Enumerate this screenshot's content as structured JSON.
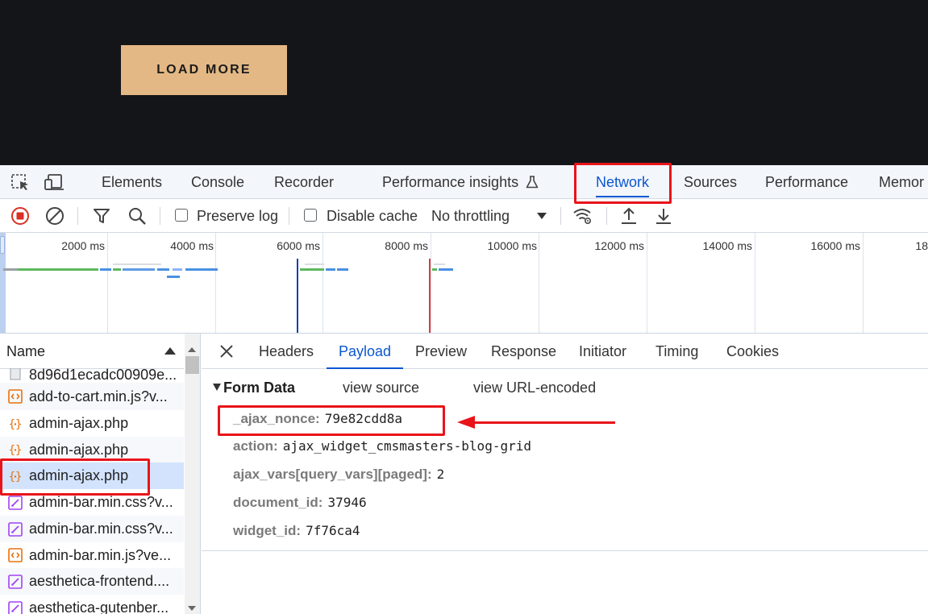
{
  "site": {
    "load_more_label": "LOAD MORE"
  },
  "devtools": {
    "tabs": [
      {
        "label": "Elements"
      },
      {
        "label": "Console"
      },
      {
        "label": "Recorder"
      },
      {
        "label": "Performance insights"
      },
      {
        "label": "Network",
        "active": true
      },
      {
        "label": "Sources"
      },
      {
        "label": "Performance"
      },
      {
        "label": "Memor"
      }
    ],
    "toolbar": {
      "preserve_log_label": "Preserve log",
      "preserve_log_checked": false,
      "disable_cache_label": "Disable cache",
      "disable_cache_checked": false,
      "throttling_value": "No throttling"
    },
    "overview": {
      "ticks": [
        "2000 ms",
        "4000 ms",
        "6000 ms",
        "8000 ms",
        "10000 ms",
        "12000 ms",
        "14000 ms",
        "16000 ms",
        "18"
      ]
    },
    "request_list": {
      "column_header": "Name",
      "rows": [
        {
          "name": "8d96d1ecadc00909e...",
          "type": "image"
        },
        {
          "name": "add-to-cart.min.js?v...",
          "type": "script"
        },
        {
          "name": "admin-ajax.php",
          "type": "xhr"
        },
        {
          "name": "admin-ajax.php",
          "type": "xhr"
        },
        {
          "name": "admin-ajax.php",
          "type": "xhr",
          "selected": true
        },
        {
          "name": "admin-bar.min.css?v...",
          "type": "stylesheet"
        },
        {
          "name": "admin-bar.min.css?v...",
          "type": "stylesheet"
        },
        {
          "name": "admin-bar.min.js?ve...",
          "type": "script"
        },
        {
          "name": "aesthetica-frontend....",
          "type": "stylesheet"
        },
        {
          "name": "aesthetica-gutenber...",
          "type": "stylesheet"
        }
      ]
    },
    "details": {
      "tabs": [
        {
          "label": "Headers"
        },
        {
          "label": "Payload",
          "active": true
        },
        {
          "label": "Preview"
        },
        {
          "label": "Response"
        },
        {
          "label": "Initiator"
        },
        {
          "label": "Timing"
        },
        {
          "label": "Cookies"
        }
      ],
      "form_data_title": "Form Data",
      "view_source_label": "view source",
      "view_url_encoded_label": "view URL-encoded",
      "fields": [
        {
          "key": "_ajax_nonce:",
          "value": "79e82cdd8a"
        },
        {
          "key": "action:",
          "value": "ajax_widget_cmsmasters-blog-grid"
        },
        {
          "key": "ajax_vars[query_vars][paged]:",
          "value": "2"
        },
        {
          "key": "document_id:",
          "value": "37946"
        },
        {
          "key": "widget_id:",
          "value": "7f76ca4"
        }
      ]
    }
  },
  "colors": {
    "accent": "#0b57d0",
    "annotation": "#e8141a",
    "button": "#e3b884",
    "page_bg": "#141518"
  }
}
